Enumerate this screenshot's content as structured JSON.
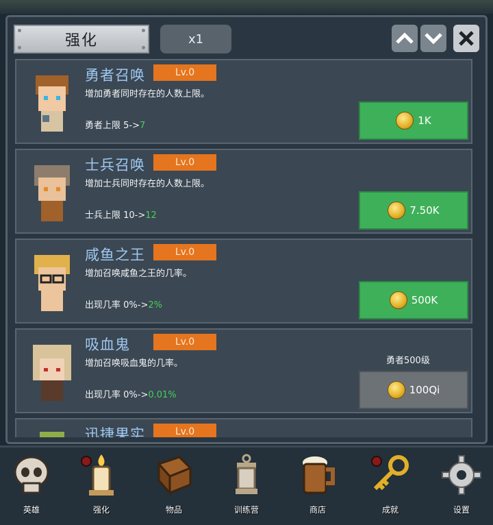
{
  "header": {
    "title": "强化",
    "multiplier": "x1"
  },
  "colors": {
    "level_badge": "#e5751e",
    "buy_button": "#3fb05a",
    "locked_button": "#6d7276",
    "name_text": "#9fc8f0",
    "new_value": "#46d05a"
  },
  "upgrades": [
    {
      "name": "勇者召唤",
      "level": "Lv.0",
      "desc": "增加勇者同时存在的人数上限。",
      "stat_prefix": "勇者上限 5->",
      "stat_new": "7",
      "cost": "1K",
      "requirement": ""
    },
    {
      "name": "士兵召唤",
      "level": "Lv.0",
      "desc": "增加士兵同时存在的人数上限。",
      "stat_prefix": "士兵上限 10->",
      "stat_new": "12",
      "cost": "7.50K",
      "requirement": ""
    },
    {
      "name": "咸鱼之王",
      "level": "Lv.0",
      "desc": "增加召唤咸鱼之王的几率。",
      "stat_prefix": "出现几率 0%->",
      "stat_new": "2%",
      "cost": "500K",
      "requirement": ""
    },
    {
      "name": "吸血鬼",
      "level": "Lv.0",
      "desc": "增加召唤吸血鬼的几率。",
      "stat_prefix": "出现几率 0%->",
      "stat_new": "0.01%",
      "cost": "100Qi",
      "requirement": "勇者500级"
    },
    {
      "name": "迅捷果实",
      "level": "Lv.0",
      "desc": "",
      "stat_prefix": "",
      "stat_new": "",
      "cost": "",
      "requirement": ""
    }
  ],
  "nav": [
    {
      "label": "英雄",
      "icon": "skull-icon"
    },
    {
      "label": "强化",
      "icon": "candle-icon"
    },
    {
      "label": "物品",
      "icon": "book-icon"
    },
    {
      "label": "训练营",
      "icon": "lantern-icon"
    },
    {
      "label": "商店",
      "icon": "beer-mug-icon"
    },
    {
      "label": "成就",
      "icon": "key-icon"
    },
    {
      "label": "设置",
      "icon": "gear-icon"
    }
  ]
}
